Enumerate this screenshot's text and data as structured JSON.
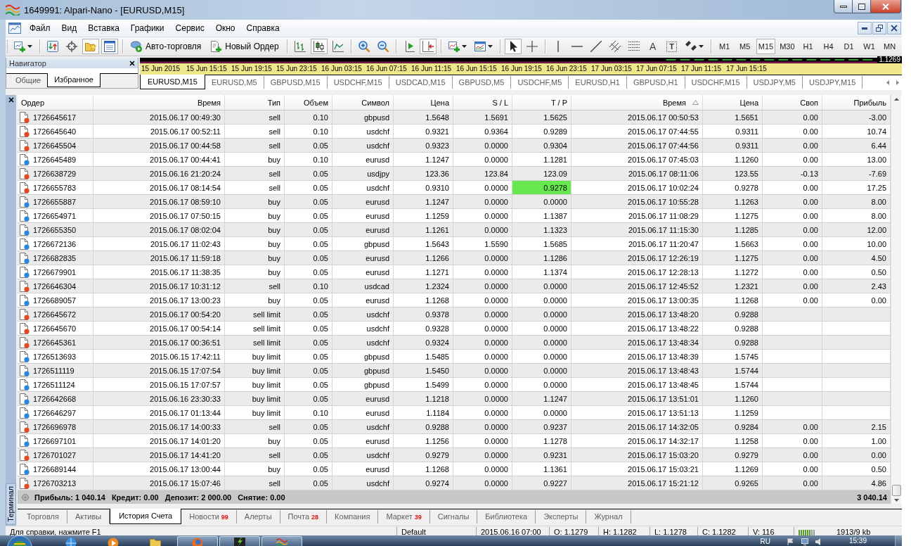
{
  "window": {
    "title": "1649991: Alpari-Nano - [EURUSD,M15]"
  },
  "menu": [
    "Файл",
    "Вид",
    "Вставка",
    "Графики",
    "Сервис",
    "Окно",
    "Справка"
  ],
  "toolbar": [
    {
      "kind": "newchart",
      "pressed": false
    },
    {
      "kind": "separator"
    },
    {
      "kind": "profiles",
      "pressed": false
    },
    {
      "kind": "target",
      "pressed": false
    },
    {
      "kind": "folderstar",
      "pressed": true
    },
    {
      "kind": "terminal",
      "pressed": true
    },
    {
      "kind": "separator"
    },
    {
      "kind": "autotrade",
      "label": "Авто-торговля",
      "pressed": false
    },
    {
      "kind": "neworder",
      "label": "Новый Ордер",
      "pressed": false
    },
    {
      "kind": "separator"
    },
    {
      "kind": "bars",
      "pressed": false
    },
    {
      "kind": "candles",
      "pressed": true
    },
    {
      "kind": "linechart",
      "pressed": false
    },
    {
      "kind": "separator"
    },
    {
      "kind": "zoomin",
      "pressed": false
    },
    {
      "kind": "zoomout",
      "pressed": false
    },
    {
      "kind": "separator"
    },
    {
      "kind": "shift",
      "pressed": false
    },
    {
      "kind": "autoscroll",
      "pressed": true
    },
    {
      "kind": "separator"
    },
    {
      "kind": "indicators",
      "pressed": false
    },
    {
      "kind": "templates",
      "pressed": false
    },
    {
      "kind": "separator"
    },
    {
      "kind": "cursor",
      "pressed": true
    },
    {
      "kind": "crosshair",
      "pressed": false
    },
    {
      "kind": "separator"
    },
    {
      "kind": "vline",
      "pressed": false
    },
    {
      "kind": "hline",
      "pressed": false
    },
    {
      "kind": "trendline",
      "pressed": false
    },
    {
      "kind": "channel",
      "pressed": false
    },
    {
      "kind": "fibo",
      "pressed": false
    },
    {
      "kind": "letter",
      "label": "A",
      "pressed": false
    },
    {
      "kind": "boxedletter",
      "label": "T",
      "pressed": false
    },
    {
      "kind": "arrows",
      "pressed": false
    },
    {
      "kind": "separator"
    }
  ],
  "timeframes": [
    {
      "label": "M1",
      "selected": false
    },
    {
      "label": "M5",
      "selected": false
    },
    {
      "label": "M15",
      "selected": true
    },
    {
      "label": "M30",
      "selected": false
    },
    {
      "label": "H1",
      "selected": false
    },
    {
      "label": "H4",
      "selected": false
    },
    {
      "label": "D1",
      "selected": false
    },
    {
      "label": "W1",
      "selected": false
    },
    {
      "label": "MN",
      "selected": false
    }
  ],
  "navigator": {
    "title": "Навигатор",
    "tabs": [
      {
        "label": "Общие",
        "selected": false
      },
      {
        "label": "Избранное",
        "selected": true
      }
    ]
  },
  "chart": {
    "price": "1.1269",
    "time_labels": [
      "15 Jun 2015",
      "15 Jun 15:15",
      "15 Jun 19:15",
      "15 Jun 23:15",
      "16 Jun 03:15",
      "16 Jun 07:15",
      "16 Jun 11:15",
      "16 Jun 15:15",
      "16 Jun 19:15",
      "16 Jun 23:15",
      "17 Jun 03:15",
      "17 Jun 07:15",
      "17 Jun 11:15",
      "17 Jun 15:15"
    ]
  },
  "chart_tabs": [
    {
      "label": "EURUSD,M15",
      "selected": true
    },
    {
      "label": "EURUSD,M5",
      "selected": false
    },
    {
      "label": "GBPUSD,M15",
      "selected": false
    },
    {
      "label": "USDCHF,M15",
      "selected": false
    },
    {
      "label": "USDCAD,M15",
      "selected": false
    },
    {
      "label": "GBPUSD,M5",
      "selected": false
    },
    {
      "label": "USDCHF,M5",
      "selected": false
    },
    {
      "label": "EURUSD,H1",
      "selected": false
    },
    {
      "label": "GBPUSD,H1",
      "selected": false
    },
    {
      "label": "USDCHF,M15",
      "selected": false
    },
    {
      "label": "USDJPY,M5",
      "selected": false
    },
    {
      "label": "USDJPY,M15",
      "selected": false
    }
  ],
  "terminal": {
    "label": "Терминал",
    "columns": [
      {
        "label": "Ордер",
        "sorted": false
      },
      {
        "label": "Время",
        "sorted": false
      },
      {
        "label": "Тип",
        "sorted": false
      },
      {
        "label": "Объем",
        "sorted": false
      },
      {
        "label": "Символ",
        "sorted": false
      },
      {
        "label": "Цена",
        "sorted": false
      },
      {
        "label": "S / L",
        "sorted": false
      },
      {
        "label": "T / P",
        "sorted": false
      },
      {
        "label": "Время",
        "sorted": true
      },
      {
        "label": "Цена",
        "sorted": false
      },
      {
        "label": "Своп",
        "sorted": false
      },
      {
        "label": "Прибыль",
        "sorted": false
      }
    ],
    "rows": [
      {
        "order": "1726645617",
        "open_time": "2015.06.17 00:49:30",
        "type": "sell",
        "volume": "0.10",
        "symbol": "gbpusd",
        "open_price": "1.5648",
        "sl": "1.5691",
        "tp": "1.5625",
        "close_time": "2015.06.17 00:50:53",
        "close_price": "1.5651",
        "swap": "0.00",
        "profit": "-3.00",
        "color": "#e04a1c",
        "tp_highlighted": false
      },
      {
        "order": "1726645640",
        "open_time": "2015.06.17 00:52:11",
        "type": "sell",
        "volume": "0.10",
        "symbol": "usdchf",
        "open_price": "0.9321",
        "sl": "0.9364",
        "tp": "0.9289",
        "close_time": "2015.06.17 07:44:55",
        "close_price": "0.9311",
        "swap": "0.00",
        "profit": "10.74",
        "color": "#e04a1c",
        "tp_highlighted": false
      },
      {
        "order": "1726645504",
        "open_time": "2015.06.17 00:44:58",
        "type": "sell",
        "volume": "0.05",
        "symbol": "usdchf",
        "open_price": "0.9323",
        "sl": "0.0000",
        "tp": "0.9304",
        "close_time": "2015.06.17 07:44:56",
        "close_price": "0.9311",
        "swap": "0.00",
        "profit": "6.44",
        "color": "#e04a1c",
        "tp_highlighted": false
      },
      {
        "order": "1726645489",
        "open_time": "2015.06.17 00:44:41",
        "type": "buy",
        "volume": "0.10",
        "symbol": "eurusd",
        "open_price": "1.1247",
        "sl": "0.0000",
        "tp": "1.1281",
        "close_time": "2015.06.17 07:45:03",
        "close_price": "1.1260",
        "swap": "0.00",
        "profit": "13.00",
        "color": "#2a86dc",
        "tp_highlighted": false
      },
      {
        "order": "1726638729",
        "open_time": "2015.06.16 21:20:24",
        "type": "sell",
        "volume": "0.05",
        "symbol": "usdjpy",
        "open_price": "123.36",
        "sl": "123.84",
        "tp": "123.09",
        "close_time": "2015.06.17 08:11:06",
        "close_price": "123.55",
        "swap": "-0.13",
        "profit": "-7.69",
        "color": "#e04a1c",
        "tp_highlighted": false
      },
      {
        "order": "1726655783",
        "open_time": "2015.06.17 08:14:54",
        "type": "sell",
        "volume": "0.05",
        "symbol": "usdchf",
        "open_price": "0.9310",
        "sl": "0.0000",
        "tp": "0.9278",
        "close_time": "2015.06.17 10:02:24",
        "close_price": "0.9278",
        "swap": "0.00",
        "profit": "17.25",
        "color": "#e04a1c",
        "tp_highlighted": true
      },
      {
        "order": "1726655887",
        "open_time": "2015.06.17 08:59:10",
        "type": "buy",
        "volume": "0.05",
        "symbol": "eurusd",
        "open_price": "1.1247",
        "sl": "0.0000",
        "tp": "0.0000",
        "close_time": "2015.06.17 10:55:28",
        "close_price": "1.1263",
        "swap": "0.00",
        "profit": "8.00",
        "color": "#2a86dc",
        "tp_highlighted": false
      },
      {
        "order": "1726654971",
        "open_time": "2015.06.17 07:50:15",
        "type": "buy",
        "volume": "0.05",
        "symbol": "eurusd",
        "open_price": "1.1259",
        "sl": "0.0000",
        "tp": "1.1387",
        "close_time": "2015.06.17 11:08:29",
        "close_price": "1.1275",
        "swap": "0.00",
        "profit": "8.00",
        "color": "#2a86dc",
        "tp_highlighted": false
      },
      {
        "order": "1726655350",
        "open_time": "2015.06.17 08:02:04",
        "type": "buy",
        "volume": "0.05",
        "symbol": "eurusd",
        "open_price": "1.1261",
        "sl": "0.0000",
        "tp": "1.1323",
        "close_time": "2015.06.17 11:15:30",
        "close_price": "1.1285",
        "swap": "0.00",
        "profit": "12.00",
        "color": "#2a86dc",
        "tp_highlighted": false
      },
      {
        "order": "1726672136",
        "open_time": "2015.06.17 11:02:43",
        "type": "buy",
        "volume": "0.05",
        "symbol": "gbpusd",
        "open_price": "1.5643",
        "sl": "1.5590",
        "tp": "1.5685",
        "close_time": "2015.06.17 11:20:47",
        "close_price": "1.5663",
        "swap": "0.00",
        "profit": "10.00",
        "color": "#2a86dc",
        "tp_highlighted": false
      },
      {
        "order": "1726682835",
        "open_time": "2015.06.17 11:59:18",
        "type": "buy",
        "volume": "0.05",
        "symbol": "eurusd",
        "open_price": "1.1266",
        "sl": "0.0000",
        "tp": "1.1286",
        "close_time": "2015.06.17 12:26:19",
        "close_price": "1.1275",
        "swap": "0.00",
        "profit": "4.50",
        "color": "#2a86dc",
        "tp_highlighted": false
      },
      {
        "order": "1726679901",
        "open_time": "2015.06.17 11:38:35",
        "type": "buy",
        "volume": "0.05",
        "symbol": "eurusd",
        "open_price": "1.1271",
        "sl": "0.0000",
        "tp": "1.1374",
        "close_time": "2015.06.17 12:28:13",
        "close_price": "1.1272",
        "swap": "0.00",
        "profit": "0.50",
        "color": "#2a86dc",
        "tp_highlighted": false
      },
      {
        "order": "1726646304",
        "open_time": "2015.06.17 10:31:12",
        "type": "sell",
        "volume": "0.10",
        "symbol": "usdcad",
        "open_price": "1.2324",
        "sl": "0.0000",
        "tp": "0.0000",
        "close_time": "2015.06.17 12:45:52",
        "close_price": "1.2321",
        "swap": "0.00",
        "profit": "2.43",
        "color": "#e04a1c",
        "tp_highlighted": false
      },
      {
        "order": "1726689057",
        "open_time": "2015.06.17 13:00:23",
        "type": "buy",
        "volume": "0.05",
        "symbol": "eurusd",
        "open_price": "1.1268",
        "sl": "0.0000",
        "tp": "0.0000",
        "close_time": "2015.06.17 13:00:35",
        "close_price": "1.1268",
        "swap": "0.00",
        "profit": "0.00",
        "color": "#2a86dc",
        "tp_highlighted": false
      },
      {
        "order": "1726645672",
        "open_time": "2015.06.17 00:54:20",
        "type": "sell limit",
        "volume": "0.05",
        "symbol": "usdchf",
        "open_price": "0.9378",
        "sl": "0.0000",
        "tp": "0.0000",
        "close_time": "2015.06.17 13:48:20",
        "close_price": "0.9288",
        "color": "#e04a1c",
        "tp_highlighted": false
      },
      {
        "order": "1726645670",
        "open_time": "2015.06.17 00:54:14",
        "type": "sell limit",
        "volume": "0.05",
        "symbol": "usdchf",
        "open_price": "0.9328",
        "sl": "0.0000",
        "tp": "0.0000",
        "close_time": "2015.06.17 13:48:22",
        "close_price": "0.9288",
        "color": "#e04a1c",
        "tp_highlighted": false
      },
      {
        "order": "1726645361",
        "open_time": "2015.06.17 00:36:51",
        "type": "sell limit",
        "volume": "0.05",
        "symbol": "usdchf",
        "open_price": "0.9324",
        "sl": "0.0000",
        "tp": "0.0000",
        "close_time": "2015.06.17 13:48:34",
        "close_price": "0.9288",
        "color": "#e04a1c",
        "tp_highlighted": false
      },
      {
        "order": "1726513693",
        "open_time": "2015.06.15 17:42:11",
        "type": "buy limit",
        "volume": "0.05",
        "symbol": "gbpusd",
        "open_price": "1.5485",
        "sl": "0.0000",
        "tp": "0.0000",
        "close_time": "2015.06.17 13:48:39",
        "close_price": "1.5745",
        "color": "#2a86dc",
        "tp_highlighted": false
      },
      {
        "order": "1726511119",
        "open_time": "2015.06.15 17:07:54",
        "type": "buy limit",
        "volume": "0.05",
        "symbol": "gbpusd",
        "open_price": "1.5450",
        "sl": "0.0000",
        "tp": "0.0000",
        "close_time": "2015.06.17 13:48:43",
        "close_price": "1.5744",
        "color": "#2a86dc",
        "tp_highlighted": false
      },
      {
        "order": "1726511124",
        "open_time": "2015.06.15 17:07:57",
        "type": "buy limit",
        "volume": "0.05",
        "symbol": "gbpusd",
        "open_price": "1.5499",
        "sl": "0.0000",
        "tp": "0.0000",
        "close_time": "2015.06.17 13:48:45",
        "close_price": "1.5744",
        "color": "#2a86dc",
        "tp_highlighted": false
      },
      {
        "order": "1726642668",
        "open_time": "2015.06.16 23:30:33",
        "type": "buy limit",
        "volume": "0.05",
        "symbol": "eurusd",
        "open_price": "1.1218",
        "sl": "0.0000",
        "tp": "1.1247",
        "close_time": "2015.06.17 13:51:01",
        "close_price": "1.1260",
        "color": "#2a86dc",
        "tp_highlighted": false
      },
      {
        "order": "1726646297",
        "open_time": "2015.06.17 01:13:44",
        "type": "buy limit",
        "volume": "0.10",
        "symbol": "eurusd",
        "open_price": "1.1184",
        "sl": "0.0000",
        "tp": "0.0000",
        "close_time": "2015.06.17 13:51:13",
        "close_price": "1.1259",
        "color": "#2a86dc",
        "tp_highlighted": false
      },
      {
        "order": "1726696978",
        "open_time": "2015.06.17 14:00:33",
        "type": "sell",
        "volume": "0.05",
        "symbol": "usdchf",
        "open_price": "0.9288",
        "sl": "0.0000",
        "tp": "0.9237",
        "close_time": "2015.06.17 14:32:05",
        "close_price": "0.9284",
        "swap": "0.00",
        "profit": "2.15",
        "color": "#e04a1c",
        "tp_highlighted": false
      },
      {
        "order": "1726697101",
        "open_time": "2015.06.17 14:01:20",
        "type": "buy",
        "volume": "0.05",
        "symbol": "eurusd",
        "open_price": "1.1256",
        "sl": "0.0000",
        "tp": "1.1278",
        "close_time": "2015.06.17 14:32:17",
        "close_price": "1.1258",
        "swap": "0.00",
        "profit": "1.00",
        "color": "#2a86dc",
        "tp_highlighted": false
      },
      {
        "order": "1726701027",
        "open_time": "2015.06.17 14:41:20",
        "type": "sell",
        "volume": "0.05",
        "symbol": "usdchf",
        "open_price": "0.9279",
        "sl": "0.0000",
        "tp": "0.9231",
        "close_time": "2015.06.17 15:03:20",
        "close_price": "0.9279",
        "swap": "0.00",
        "profit": "0.00",
        "color": "#e04a1c",
        "tp_highlighted": false
      },
      {
        "order": "1726689144",
        "open_time": "2015.06.17 13:00:44",
        "type": "buy",
        "volume": "0.05",
        "symbol": "eurusd",
        "open_price": "1.1268",
        "sl": "0.0000",
        "tp": "1.1361",
        "close_time": "2015.06.17 15:03:21",
        "close_price": "1.1269",
        "swap": "0.00",
        "profit": "0.50",
        "color": "#2a86dc",
        "tp_highlighted": false
      },
      {
        "order": "1726703213",
        "open_time": "2015.06.17 15:07:46",
        "type": "sell",
        "volume": "0.05",
        "symbol": "usdchf",
        "open_price": "0.9274",
        "sl": "0.0000",
        "tp": "0.9227",
        "close_time": "2015.06.17 15:21:12",
        "close_price": "0.9265",
        "swap": "0.00",
        "profit": "4.86",
        "color": "#e04a1c",
        "tp_highlighted": false
      }
    ],
    "summary": {
      "items": [
        "Прибыль: 1 040.14",
        "Кредит: 0.00",
        "Депозит: 2 000.00",
        "Снятие: 0.00"
      ],
      "total": "3 040.14"
    },
    "tabs": [
      {
        "label": "Торговля",
        "selected": false
      },
      {
        "label": "Активы",
        "selected": false
      },
      {
        "label": "История Счета",
        "selected": true
      },
      {
        "label": "Новости",
        "badge": "99",
        "selected": false
      },
      {
        "label": "Алерты",
        "selected": false
      },
      {
        "label": "Почта",
        "badge": "28",
        "selected": false
      },
      {
        "label": "Компания",
        "selected": false
      },
      {
        "label": "Маркет",
        "badge": "39",
        "selected": false
      },
      {
        "label": "Сигналы",
        "selected": false
      },
      {
        "label": "Библиотека",
        "selected": false
      },
      {
        "label": "Эксперты",
        "selected": false
      },
      {
        "label": "Журнал",
        "selected": false
      }
    ]
  },
  "status_bar": {
    "help": "Для справки, нажмите F1",
    "profile": "Default",
    "fields": [
      "2015.06.16 07:00",
      "O: 1.1279",
      "H: 1.1282",
      "L: 1.1278",
      "C: 1.1282",
      "V: 116"
    ],
    "traffic": "1913/9 kb"
  },
  "taskbar": {
    "apps": [
      {
        "kind": "globe",
        "running": false
      },
      {
        "kind": "media",
        "running": false
      },
      {
        "kind": "folder",
        "running": false
      },
      {
        "kind": "firefox",
        "running": true
      },
      {
        "kind": "lightning",
        "running": true
      },
      {
        "kind": "waves",
        "running": true
      }
    ],
    "language": "RU",
    "clock": "15:39"
  }
}
